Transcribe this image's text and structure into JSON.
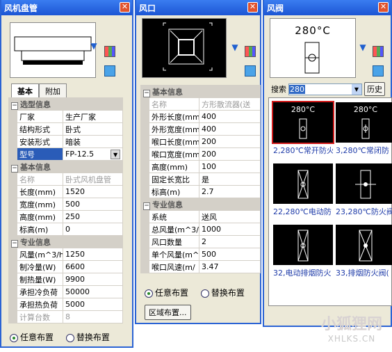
{
  "panel_coil": {
    "title": "风机盘管",
    "tabs": [
      "基本",
      "附加"
    ],
    "groups": [
      {
        "name": "选型信息",
        "rows": [
          {
            "key": "厂家",
            "value": "生产厂家"
          },
          {
            "key": "结构形式",
            "value": "卧式"
          },
          {
            "key": "安装形式",
            "value": "暗装"
          },
          {
            "key": "型号",
            "value": "FP-12.5"
          }
        ]
      },
      {
        "name": "基本信息",
        "rows": [
          {
            "key": "名称",
            "value": "卧式风机盘管"
          },
          {
            "key": "长度(mm)",
            "value": "1520"
          },
          {
            "key": "宽度(mm)",
            "value": "500"
          },
          {
            "key": "高度(mm)",
            "value": "250"
          },
          {
            "key": "标高(m)",
            "value": "0"
          }
        ]
      },
      {
        "name": "专业信息",
        "rows": [
          {
            "key": "风量(m^3/h)",
            "value": "1250"
          },
          {
            "key": "制冷量(W)",
            "value": "6600"
          },
          {
            "key": "制热量(W)",
            "value": "9900"
          },
          {
            "key": "承担冷负荷",
            "value": "50000"
          },
          {
            "key": "承担热负荷",
            "value": "5000"
          },
          {
            "key": "计算台数",
            "value": "8"
          }
        ]
      }
    ],
    "radio_1": "任意布置",
    "radio_2": "替换布置"
  },
  "panel_outlet": {
    "title": "风口",
    "groups": [
      {
        "name": "基本信息",
        "rows": [
          {
            "key": "名称",
            "value": "方形散流器(送"
          },
          {
            "key": "外形长度(mm",
            "value": "400"
          },
          {
            "key": "外形宽度(mm",
            "value": "400"
          },
          {
            "key": "喉口长度(mm",
            "value": "200"
          },
          {
            "key": "喉口宽度(mm",
            "value": "200"
          },
          {
            "key": "高度(mm)",
            "value": "100"
          },
          {
            "key": "固定长宽比",
            "value": "是"
          },
          {
            "key": "标高(m)",
            "value": "2.7"
          }
        ]
      },
      {
        "name": "专业信息",
        "rows": [
          {
            "key": "系统",
            "value": "送风"
          },
          {
            "key": "总风量(m^3/",
            "value": "1000"
          },
          {
            "key": "风口数量",
            "value": "2"
          },
          {
            "key": "单个风量(m^",
            "value": "500"
          },
          {
            "key": "喉口风速(m/",
            "value": "3.47"
          }
        ]
      }
    ],
    "radio_1": "任意布置",
    "radio_2": "替换布置",
    "area_button": "区域布置..."
  },
  "panel_damper": {
    "title": "风阀",
    "preview_temp": "280°C",
    "search_label": "搜索",
    "search_value": "280",
    "history_button": "历史",
    "thumbs": [
      {
        "temp": "280°C",
        "caption": "2,280℃常开防火"
      },
      {
        "temp": "280°C",
        "caption": "3,280℃常闭防"
      },
      {
        "temp": "",
        "caption": "22,280℃电动防"
      },
      {
        "temp": "",
        "caption": "23,280℃防火阀"
      },
      {
        "temp": "",
        "caption": "32,电动排烟防火"
      },
      {
        "temp": "",
        "caption": "33,排烟防火阀("
      }
    ]
  },
  "watermark": {
    "big": "小狐狸网",
    "small": "XHLKS.CN"
  },
  "colors": {
    "title_bar": "#1c55d4",
    "panel_bg": "#ece9d8",
    "selected_outline": "#d01a1a",
    "caption": "#1d3aa8"
  }
}
